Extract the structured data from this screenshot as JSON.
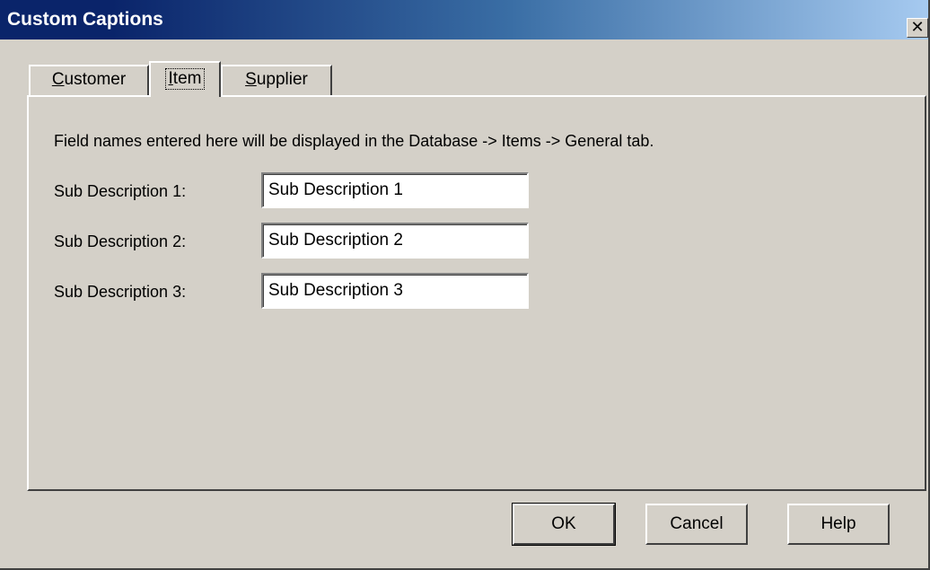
{
  "window": {
    "title": "Custom Captions",
    "close_glyph": "✕"
  },
  "tabs": [
    {
      "label_hotkey": "C",
      "label_rest": "ustomer",
      "active": false
    },
    {
      "label_hotkey": "I",
      "label_rest": "tem",
      "active": true
    },
    {
      "label_hotkey": "S",
      "label_rest": "upplier",
      "active": false
    }
  ],
  "panel": {
    "info": "Field names entered here will be displayed in the Database -> Items -> General tab.",
    "fields": [
      {
        "label": "Sub Description 1:",
        "value": "Sub Description 1"
      },
      {
        "label": "Sub Description 2:",
        "value": "Sub Description 2"
      },
      {
        "label": "Sub Description 3:",
        "value": "Sub Description 3"
      }
    ]
  },
  "buttons": {
    "ok": "OK",
    "cancel": "Cancel",
    "help": "Help"
  }
}
